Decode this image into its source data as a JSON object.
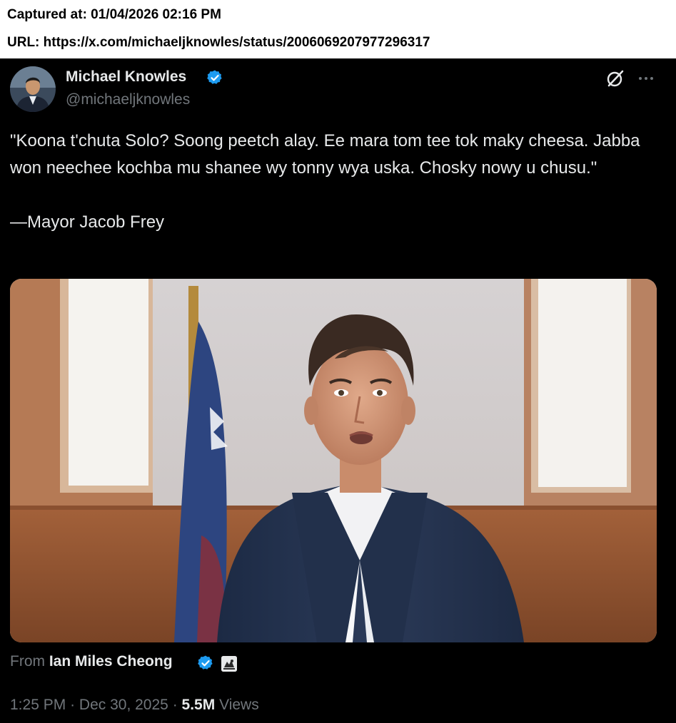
{
  "capture": {
    "captured_at": "Captured at: 01/04/2026 02:16 PM",
    "url": "URL: https://x.com/michaeljknowles/status/2006069207977296317"
  },
  "author": {
    "name": "Michael Knowles",
    "handle": "@michaeljknowles"
  },
  "tweet": {
    "text": "\"Koona t'chuta Solo? Soong peetch alay. Ee mara tom tee tok maky cheesa. Jabba won neechee kochba mu shanee wy tonny wya uska. Chosky nowy u chusu.\"",
    "attribution": "—Mayor Jacob Frey"
  },
  "source": {
    "prefix": "From",
    "name": "Ian Miles Cheong"
  },
  "meta": {
    "time": "1:25 PM",
    "separator": "·",
    "date": "Dec 30, 2025",
    "views_count": "5.5M",
    "views_label": "Views"
  },
  "colors": {
    "background": "#000000",
    "text": "#e7e9ea",
    "muted": "#71767b",
    "verified": "#1d9bf0"
  },
  "icons": [
    "verified-badge-icon",
    "grok-icon",
    "more-icon"
  ]
}
